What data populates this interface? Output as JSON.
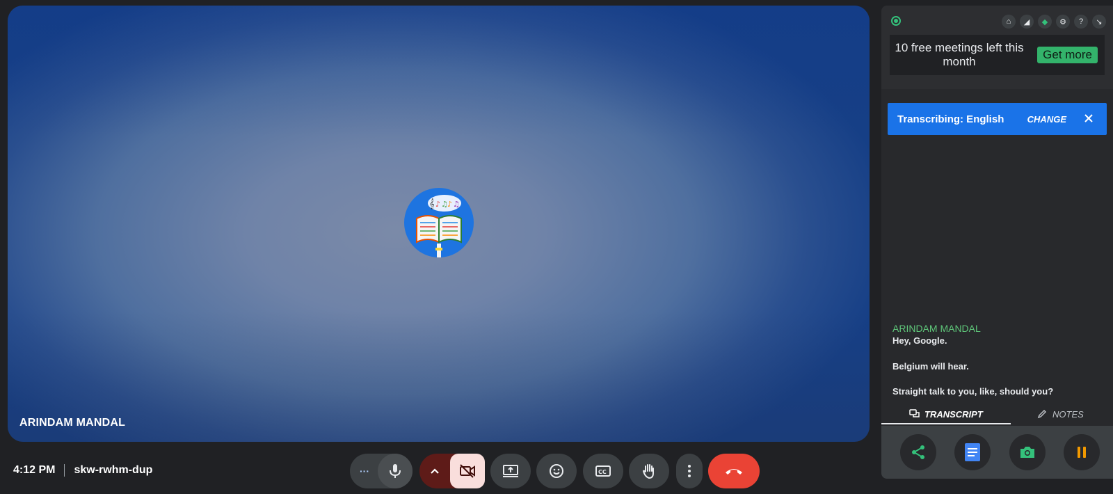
{
  "meeting": {
    "time": "4:12 PM",
    "code": "skw-rwhm-dup",
    "participant_name": "ARINDAM MANDAL"
  },
  "controls": {
    "more_dots": "···"
  },
  "panel": {
    "promo_text": "10 free meetings left this month",
    "get_more_label": "Get more",
    "banner_title": "Transcribing: English",
    "banner_change": "CHANGE",
    "transcript": {
      "speaker": "ARINDAM MANDAL",
      "lines": [
        "Hey, Google.",
        "Belgium will hear.",
        "Straight talk to you, like, should you?"
      ]
    },
    "tabs": {
      "transcript": "TRANSCRIPT",
      "notes": "NOTES"
    }
  },
  "colors": {
    "accent_blue": "#1a73e8",
    "end_call_red": "#ea4335",
    "recording_green": "#34c17b",
    "speaker_green": "#5fc77a",
    "pause_orange": "#f29900"
  },
  "icons": [
    "home-icon",
    "eraser-icon",
    "shield-icon",
    "gear-icon",
    "help-icon",
    "collapse-icon",
    "close-icon",
    "share-icon",
    "docs-icon",
    "camera-icon",
    "pause-icon",
    "mic-icon",
    "camera-off-icon",
    "present-icon",
    "emoji-icon",
    "captions-icon",
    "raise-hand-icon",
    "more-vert-icon",
    "end-call-icon"
  ]
}
